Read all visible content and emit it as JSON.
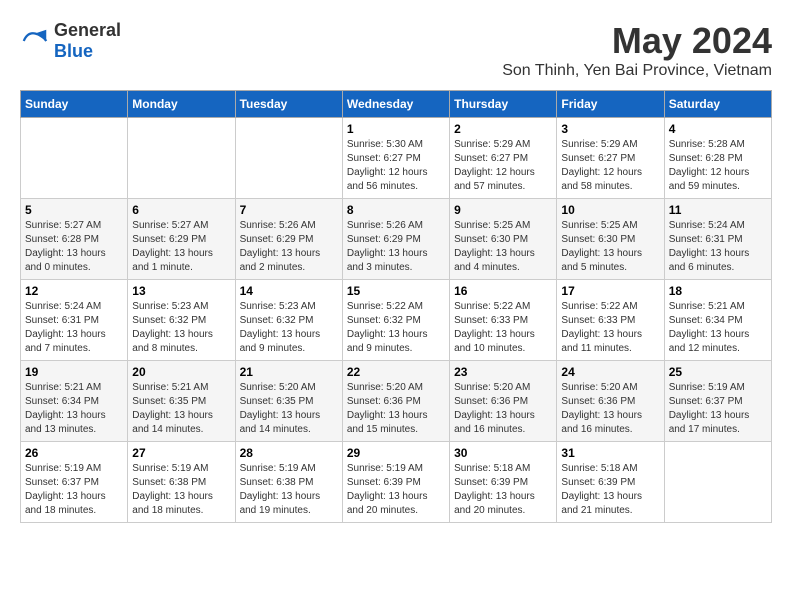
{
  "header": {
    "logo_general": "General",
    "logo_blue": "Blue",
    "month_year": "May 2024",
    "location": "Son Thinh, Yen Bai Province, Vietnam"
  },
  "calendar": {
    "days_of_week": [
      "Sunday",
      "Monday",
      "Tuesday",
      "Wednesday",
      "Thursday",
      "Friday",
      "Saturday"
    ],
    "weeks": [
      [
        {
          "day": "",
          "info": ""
        },
        {
          "day": "",
          "info": ""
        },
        {
          "day": "",
          "info": ""
        },
        {
          "day": "1",
          "info": "Sunrise: 5:30 AM\nSunset: 6:27 PM\nDaylight: 12 hours\nand 56 minutes."
        },
        {
          "day": "2",
          "info": "Sunrise: 5:29 AM\nSunset: 6:27 PM\nDaylight: 12 hours\nand 57 minutes."
        },
        {
          "day": "3",
          "info": "Sunrise: 5:29 AM\nSunset: 6:27 PM\nDaylight: 12 hours\nand 58 minutes."
        },
        {
          "day": "4",
          "info": "Sunrise: 5:28 AM\nSunset: 6:28 PM\nDaylight: 12 hours\nand 59 minutes."
        }
      ],
      [
        {
          "day": "5",
          "info": "Sunrise: 5:27 AM\nSunset: 6:28 PM\nDaylight: 13 hours\nand 0 minutes."
        },
        {
          "day": "6",
          "info": "Sunrise: 5:27 AM\nSunset: 6:29 PM\nDaylight: 13 hours\nand 1 minute."
        },
        {
          "day": "7",
          "info": "Sunrise: 5:26 AM\nSunset: 6:29 PM\nDaylight: 13 hours\nand 2 minutes."
        },
        {
          "day": "8",
          "info": "Sunrise: 5:26 AM\nSunset: 6:29 PM\nDaylight: 13 hours\nand 3 minutes."
        },
        {
          "day": "9",
          "info": "Sunrise: 5:25 AM\nSunset: 6:30 PM\nDaylight: 13 hours\nand 4 minutes."
        },
        {
          "day": "10",
          "info": "Sunrise: 5:25 AM\nSunset: 6:30 PM\nDaylight: 13 hours\nand 5 minutes."
        },
        {
          "day": "11",
          "info": "Sunrise: 5:24 AM\nSunset: 6:31 PM\nDaylight: 13 hours\nand 6 minutes."
        }
      ],
      [
        {
          "day": "12",
          "info": "Sunrise: 5:24 AM\nSunset: 6:31 PM\nDaylight: 13 hours\nand 7 minutes."
        },
        {
          "day": "13",
          "info": "Sunrise: 5:23 AM\nSunset: 6:32 PM\nDaylight: 13 hours\nand 8 minutes."
        },
        {
          "day": "14",
          "info": "Sunrise: 5:23 AM\nSunset: 6:32 PM\nDaylight: 13 hours\nand 9 minutes."
        },
        {
          "day": "15",
          "info": "Sunrise: 5:22 AM\nSunset: 6:32 PM\nDaylight: 13 hours\nand 9 minutes."
        },
        {
          "day": "16",
          "info": "Sunrise: 5:22 AM\nSunset: 6:33 PM\nDaylight: 13 hours\nand 10 minutes."
        },
        {
          "day": "17",
          "info": "Sunrise: 5:22 AM\nSunset: 6:33 PM\nDaylight: 13 hours\nand 11 minutes."
        },
        {
          "day": "18",
          "info": "Sunrise: 5:21 AM\nSunset: 6:34 PM\nDaylight: 13 hours\nand 12 minutes."
        }
      ],
      [
        {
          "day": "19",
          "info": "Sunrise: 5:21 AM\nSunset: 6:34 PM\nDaylight: 13 hours\nand 13 minutes."
        },
        {
          "day": "20",
          "info": "Sunrise: 5:21 AM\nSunset: 6:35 PM\nDaylight: 13 hours\nand 14 minutes."
        },
        {
          "day": "21",
          "info": "Sunrise: 5:20 AM\nSunset: 6:35 PM\nDaylight: 13 hours\nand 14 minutes."
        },
        {
          "day": "22",
          "info": "Sunrise: 5:20 AM\nSunset: 6:36 PM\nDaylight: 13 hours\nand 15 minutes."
        },
        {
          "day": "23",
          "info": "Sunrise: 5:20 AM\nSunset: 6:36 PM\nDaylight: 13 hours\nand 16 minutes."
        },
        {
          "day": "24",
          "info": "Sunrise: 5:20 AM\nSunset: 6:36 PM\nDaylight: 13 hours\nand 16 minutes."
        },
        {
          "day": "25",
          "info": "Sunrise: 5:19 AM\nSunset: 6:37 PM\nDaylight: 13 hours\nand 17 minutes."
        }
      ],
      [
        {
          "day": "26",
          "info": "Sunrise: 5:19 AM\nSunset: 6:37 PM\nDaylight: 13 hours\nand 18 minutes."
        },
        {
          "day": "27",
          "info": "Sunrise: 5:19 AM\nSunset: 6:38 PM\nDaylight: 13 hours\nand 18 minutes."
        },
        {
          "day": "28",
          "info": "Sunrise: 5:19 AM\nSunset: 6:38 PM\nDaylight: 13 hours\nand 19 minutes."
        },
        {
          "day": "29",
          "info": "Sunrise: 5:19 AM\nSunset: 6:39 PM\nDaylight: 13 hours\nand 20 minutes."
        },
        {
          "day": "30",
          "info": "Sunrise: 5:18 AM\nSunset: 6:39 PM\nDaylight: 13 hours\nand 20 minutes."
        },
        {
          "day": "31",
          "info": "Sunrise: 5:18 AM\nSunset: 6:39 PM\nDaylight: 13 hours\nand 21 minutes."
        },
        {
          "day": "",
          "info": ""
        }
      ]
    ]
  }
}
